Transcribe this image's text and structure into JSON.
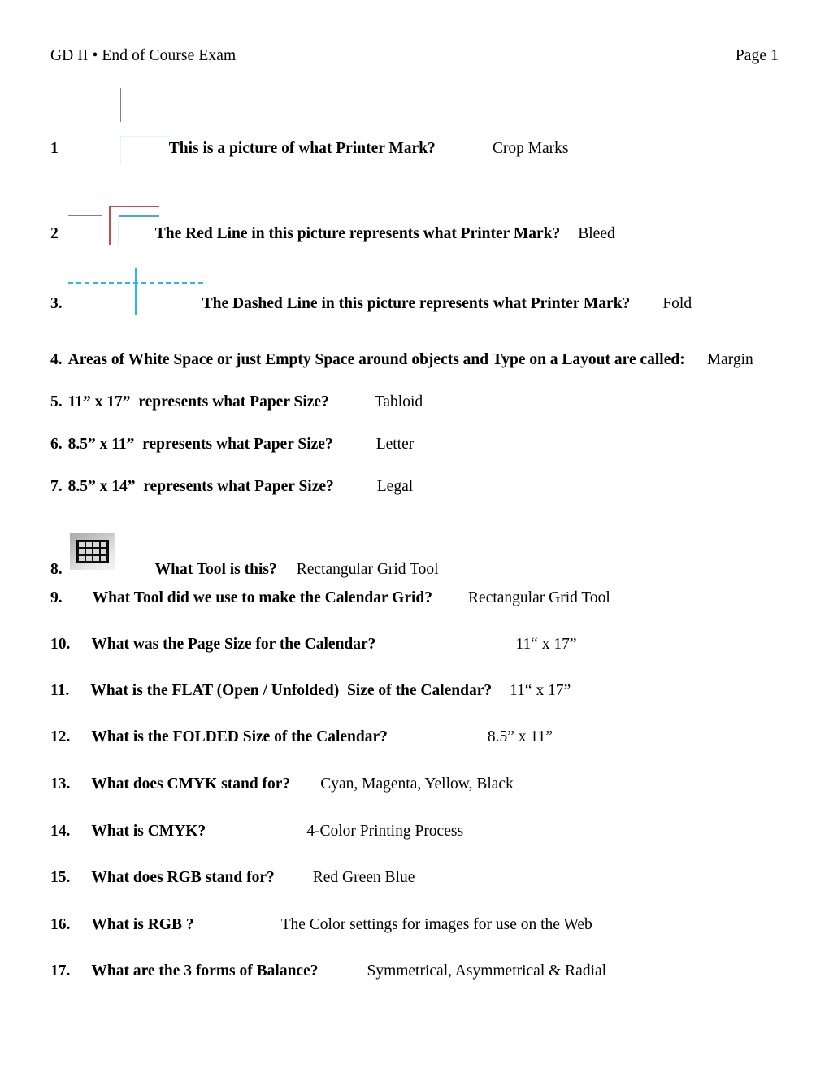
{
  "header": {
    "title": "GD II • End of Course Exam",
    "page_label": "Page 1"
  },
  "questions": [
    {
      "number": "1",
      "text": "This is a picture of what Printer Mark?",
      "answer": "Crop Marks",
      "graphic": "crop-marks-diagram"
    },
    {
      "number": "2",
      "text": "The Red Line in this picture represents what Printer Mark?",
      "answer": "Bleed",
      "graphic": "bleed-marks-diagram"
    },
    {
      "number": "3.",
      "text": "The Dashed Line in this picture represents what Printer Mark?",
      "answer": "Fold",
      "graphic": "fold-marks-diagram"
    },
    {
      "number": "4.",
      "text": "Areas of White Space or just Empty Space around objects and Type on a Layout are called:",
      "answer": "Margin"
    },
    {
      "number": "5.",
      "text": "11” x 17”  represents what Paper Size?",
      "answer": "Tabloid"
    },
    {
      "number": "6.",
      "text": "8.5” x 11”  represents what Paper Size?",
      "answer": "Letter"
    },
    {
      "number": "7.",
      "text": "8.5” x 14”  represents what Paper Size?",
      "answer": "Legal"
    },
    {
      "number": "8.",
      "text": "What Tool is this?",
      "answer": "Rectangular Grid Tool",
      "graphic": "rectangular-grid-tool-icon"
    },
    {
      "number": "9.",
      "text": "What Tool did we use to make the Calendar Grid?",
      "answer": "Rectangular Grid Tool"
    },
    {
      "number": "10.",
      "text": "What was the Page Size for the Calendar?",
      "answer": "11“ x 17”"
    },
    {
      "number": "11.",
      "text": "What is the FLAT (Open / Unfolded)  Size of the Calendar?",
      "answer": "11“ x 17”"
    },
    {
      "number": "12.",
      "text": "What is the FOLDED Size of the Calendar?",
      "answer": "8.5” x 11”"
    },
    {
      "number": "13.",
      "text": "What does CMYK stand for?",
      "answer": "Cyan, Magenta, Yellow, Black"
    },
    {
      "number": "14.",
      "text": "What is CMYK?",
      "answer": "4-Color Printing Process"
    },
    {
      "number": "15.",
      "text": "What does RGB stand for?",
      "answer": "Red Green Blue"
    },
    {
      "number": "16.",
      "text": "What is RGB ?",
      "answer": "The Color settings for images for use on the Web"
    },
    {
      "number": "17.",
      "text": "What are the 3 forms of Balance?",
      "answer": "Symmetrical, Asymmetrical & Radial"
    }
  ],
  "colors": {
    "crop_mark_gray": "#808080",
    "pale_cyan": "#e0f7f7",
    "bleed_red": "#c0504d",
    "trim_blue": "#4bacc6",
    "fold_cyan": "#29b6f6",
    "text_black": "#000000"
  }
}
